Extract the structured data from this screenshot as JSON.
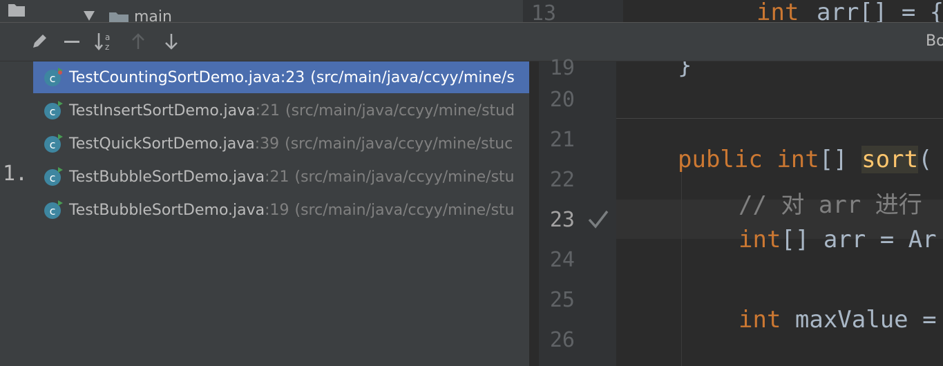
{
  "background": {
    "project_tree_folder": "main",
    "editor_top_line_number": "13",
    "editor_top_code_keyword": "int",
    "editor_top_code_rest": "arr[] = {"
  },
  "toolbar": {
    "edit_icon": "pencil-icon",
    "remove_icon": "minus-icon",
    "sort_icon": "sort-alpha-icon",
    "up_icon": "arrow-up-icon",
    "down_icon": "arrow-down-icon",
    "right_label": "Bo"
  },
  "marker": "1.",
  "breakpoints": [
    {
      "file": "TestCountingSortDemo.java",
      "line": ":23",
      "path": "(src/main/java/ccyy/mine/s",
      "selected": true
    },
    {
      "file": "TestInsertSortDemo.java",
      "line": ":21",
      "path": "(src/main/java/ccyy/mine/stud",
      "selected": false
    },
    {
      "file": "TestQuickSortDemo.java",
      "line": ":39",
      "path": "(src/main/java/ccyy/mine/stuc",
      "selected": false
    },
    {
      "file": "TestBubbleSortDemo.java",
      "line": ":21",
      "path": "(src/main/java/ccyy/mine/stu",
      "selected": false
    },
    {
      "file": "TestBubbleSortDemo.java",
      "line": ":19",
      "path": "(src/main/java/ccyy/mine/stu",
      "selected": false
    }
  ],
  "preview": {
    "line_numbers": [
      "19",
      "20",
      "21",
      "22",
      "23",
      "24",
      "25",
      "26"
    ],
    "current_line": "23",
    "code": {
      "l19": "}",
      "l21_kw1": "public",
      "l21_kw2": "int",
      "l21_brackets": "[] ",
      "l21_fn": "sort",
      "l21_paren": "(",
      "l22_comment": "// 对 arr 进行",
      "l23_kw": "int",
      "l23_rest": "[] arr = Ar",
      "l25_kw": "int",
      "l25_rest": " maxValue ="
    }
  },
  "colors": {
    "selection": "#4b6eaf",
    "keyword": "#cc7832",
    "function": "#ffc66d",
    "comment": "#808080"
  }
}
